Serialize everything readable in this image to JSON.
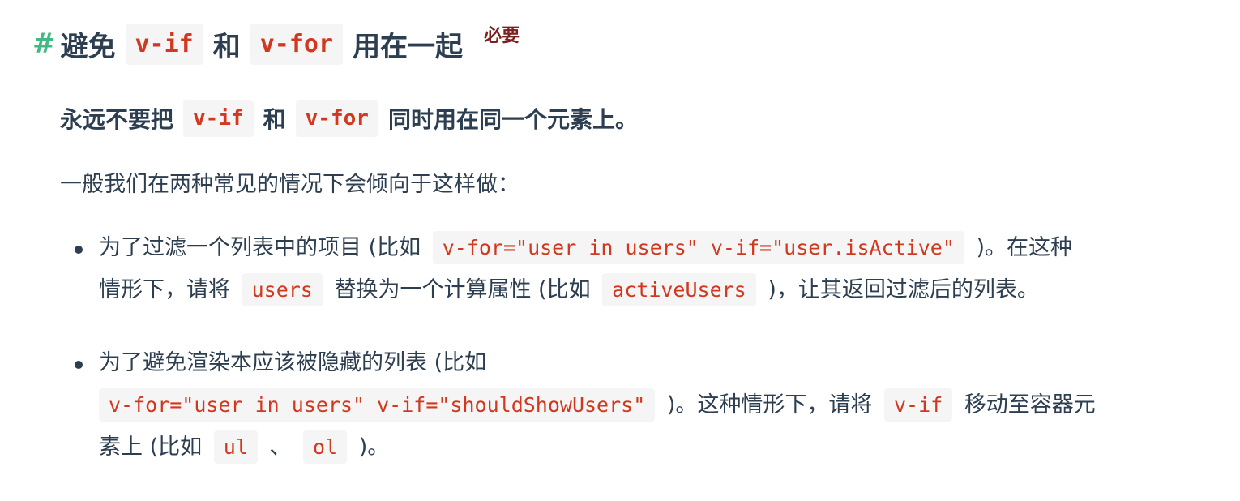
{
  "heading": {
    "hash": "#",
    "part1": "避免",
    "code1": "v-if",
    "part2": "和",
    "code2": "v-for",
    "part3": "用在一起",
    "badge": "必要"
  },
  "lead": {
    "part1": "永远不要把",
    "code1": "v-if",
    "part2": "和",
    "code2": "v-for",
    "part3": "同时用在同一个元素上。"
  },
  "paragraph": "一般我们在两种常见的情况下会倾向于这样做：",
  "items": [
    {
      "line1_text1": "为了过滤一个列表中的项目 (比如",
      "line1_code1": "v-for=\"user in users\" v-if=\"user.isActive\"",
      "line1_text2": ")。在这种",
      "line2_text1": "情形下，请将",
      "line2_code1": "users",
      "line2_text2": "替换为一个计算属性 (比如",
      "line2_code2": "activeUsers",
      "line2_text3": ")，让其返回过滤后的列表。"
    },
    {
      "line1_text1": "为了避免渲染本应该被隐藏的列表 (比如",
      "line2_code1": "v-for=\"user in users\" v-if=\"shouldShowUsers\"",
      "line2_text1": ")。这种情形下，请将",
      "line2_code2": "v-if",
      "line2_text2": "移动至容器元",
      "line3_text1": "素上 (比如",
      "line3_code1": "ul",
      "line3_text2": "、",
      "line3_code2": "ol",
      "line3_text3": ")。"
    }
  ],
  "colors": {
    "hash": "#42b983",
    "text": "#2c3e50",
    "code": "#d1381f",
    "badge": "#7a2020"
  }
}
